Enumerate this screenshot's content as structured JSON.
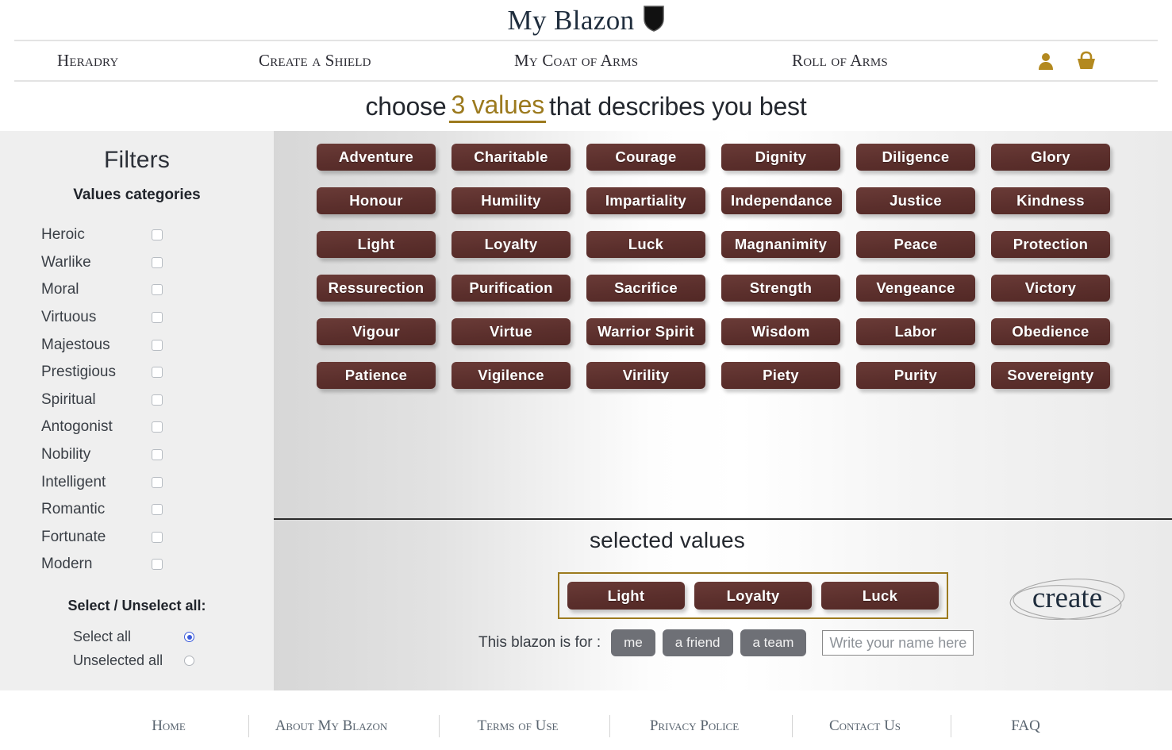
{
  "brand": {
    "title": "My Blazon",
    "shield_icon": "shield-icon"
  },
  "nav": {
    "items": [
      {
        "label": "Heradry"
      },
      {
        "label": "Create a Shield"
      },
      {
        "label": "My Coat of Arms"
      },
      {
        "label": "Roll of Arms"
      }
    ],
    "icons": [
      {
        "name": "user-icon",
        "color": "#b3891f"
      },
      {
        "name": "basket-icon",
        "color": "#b3891f"
      }
    ]
  },
  "heading": {
    "before": "choose",
    "accent": "3 values",
    "after": "that describes you best"
  },
  "sidebar": {
    "title": "Filters",
    "subtitle": "Values categories",
    "categories": [
      {
        "label": "Heroic",
        "checked": false
      },
      {
        "label": "Warlike",
        "checked": false
      },
      {
        "label": "Moral",
        "checked": false
      },
      {
        "label": "Virtuous",
        "checked": false
      },
      {
        "label": "Majestous",
        "checked": false
      },
      {
        "label": "Prestigious",
        "checked": false
      },
      {
        "label": "Spiritual",
        "checked": false
      },
      {
        "label": "Antogonist",
        "checked": false
      },
      {
        "label": "Nobility",
        "checked": false
      },
      {
        "label": "Intelligent",
        "checked": false
      },
      {
        "label": "Romantic",
        "checked": false
      },
      {
        "label": "Fortunate",
        "checked": false
      },
      {
        "label": "Modern",
        "checked": false
      }
    ],
    "select_all_title": "Select / Unselect all:",
    "select_all_label": "Select all",
    "unselect_all_label": "Unselected all",
    "select_all_checked": true
  },
  "values": [
    "Adventure",
    "Charitable",
    "Courage",
    "Dignity",
    "Diligence",
    "Glory",
    "Honour",
    "Humility",
    "Impartiality",
    "Independance",
    "Justice",
    "Kindness",
    "Light",
    "Loyalty",
    "Luck",
    "Magnanimity",
    "Peace",
    "Protection",
    "Ressurection",
    "Purification",
    "Sacrifice",
    "Strength",
    "Vengeance",
    "Victory",
    "Vigour",
    "Virtue",
    "Warrior Spirit",
    "Wisdom",
    "Labor",
    "Obedience",
    "Patience",
    "Vigilence",
    "Virility",
    "Piety",
    "Purity",
    "Sovereignty"
  ],
  "selected": {
    "title": "selected values",
    "items": [
      "Light",
      "Loyalty",
      "Luck"
    ],
    "border_color": "#9c7a1e"
  },
  "create": {
    "label": "create"
  },
  "blazon_for": {
    "label": "This blazon is for :",
    "options": [
      "me",
      "a friend",
      "a team"
    ],
    "name_placeholder": "Write your name here",
    "name_value": ""
  },
  "footer": {
    "items": [
      {
        "label": "Home"
      },
      {
        "label": "About My Blazon"
      },
      {
        "label": "Terms of Use"
      },
      {
        "label": "Privacy Police"
      },
      {
        "label": "Contact Us"
      },
      {
        "label": "FAQ"
      }
    ]
  },
  "colors": {
    "brown": "#5b2f2c",
    "gold": "#9c7a1e",
    "icon_gold": "#b3891f",
    "sidebar_bg": "#efefef"
  }
}
